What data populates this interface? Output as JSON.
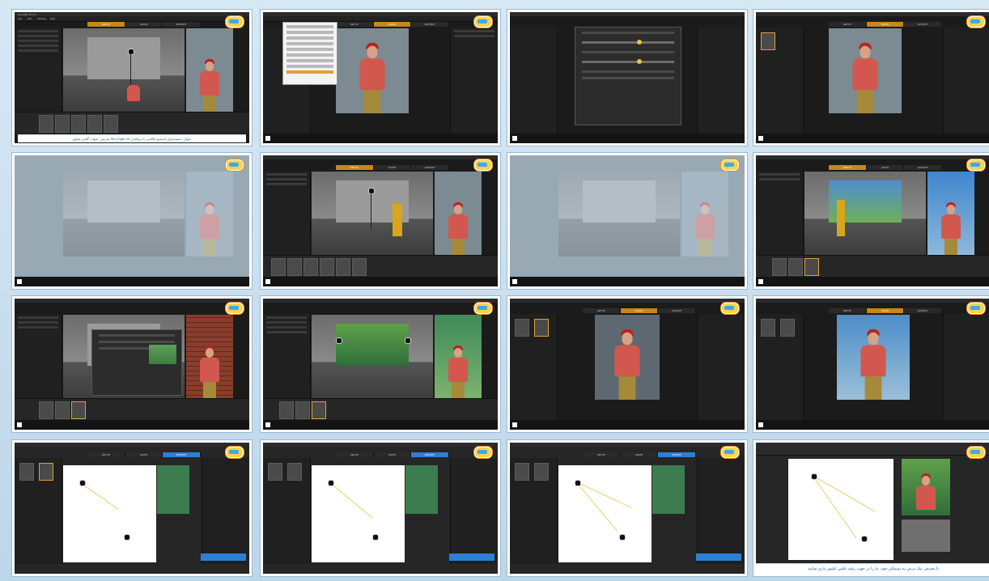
{
  "sheet": {
    "caption_top": "عنوان : شبیه‌سازی استدیو عکاسی با نرم‌افزار Set a light 3D     مدرس : شهاب گنجی معاوی",
    "caption_bottom": "با معرفی تیک درس به دوستان خود، ما را در جهت رشد علمی کشور یاری نمایید"
  },
  "app": {
    "window_title": "set.a.light 3D 2.5",
    "menu": [
      "File",
      "Edit",
      "Settings",
      "Help"
    ],
    "tabs": [
      "SETUP",
      "SHOW",
      "EXPORT"
    ]
  },
  "shots": [
    {
      "id": 1,
      "active_tab": "SETUP",
      "scene": "studio"
    },
    {
      "id": 2,
      "active_tab": "SHOW",
      "scene": "menu"
    },
    {
      "id": 3,
      "active_tab": "SETUP",
      "scene": "dialog"
    },
    {
      "id": 4,
      "active_tab": "SHOW",
      "scene": "portrait"
    },
    {
      "id": 5,
      "active_tab": "SETUP",
      "scene": "fog"
    },
    {
      "id": 6,
      "active_tab": "SETUP",
      "scene": "studio-props"
    },
    {
      "id": 7,
      "active_tab": "SETUP",
      "scene": "fog"
    },
    {
      "id": 8,
      "active_tab": "SETUP",
      "scene": "backdrop"
    },
    {
      "id": 9,
      "active_tab": "SETUP",
      "scene": "brick"
    },
    {
      "id": 10,
      "active_tab": "SETUP",
      "scene": "jungle"
    },
    {
      "id": 11,
      "active_tab": "SHOW",
      "scene": "compare"
    },
    {
      "id": 12,
      "active_tab": "SHOW",
      "scene": "portrait"
    },
    {
      "id": 13,
      "active_tab": "EXPORT",
      "scene": "plan"
    },
    {
      "id": 14,
      "active_tab": "EXPORT",
      "scene": "plan"
    },
    {
      "id": 15,
      "active_tab": "EXPORT",
      "scene": "plan"
    },
    {
      "id": 16,
      "active_tab": "EXPORT",
      "scene": "plan-large"
    }
  ]
}
